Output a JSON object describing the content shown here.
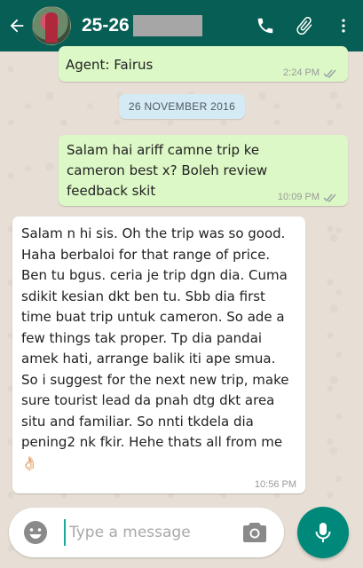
{
  "header": {
    "title": "25-26 Nov S",
    "back_icon": "arrow-left-icon",
    "actions": [
      "phone-icon",
      "paperclip-icon",
      "more-vert-icon"
    ]
  },
  "messages": [
    {
      "direction": "out",
      "text": "Agent: Fairus",
      "time": "2:24 PM",
      "status": "read"
    },
    {
      "direction": "out",
      "text": "Salam hai ariff camne trip ke cameron best x? Boleh review feedback skit",
      "time": "10:09 PM",
      "status": "read"
    },
    {
      "direction": "in",
      "text": "Salam n hi sis. Oh the trip was so good. Haha berbaloi for that range of price. Ben tu bgus. ceria je trip dgn dia. Cuma sdikit kesian dkt ben tu. Sbb dia first time buat trip untuk cameron. So ade a few things tak proper. Tp dia pandai amek hati, arrange balik iti ape smua. So i suggest for the next new trip, make sure tourist lead da pnah dtg dkt area situ and familiar. So nnti tkdela dia pening2 nk fkir. Hehe thats all from me",
      "emoji": "👌🏻",
      "time": "10:56 PM"
    }
  ],
  "date_divider": "26 NOVEMBER 2016",
  "composer": {
    "placeholder": "Type a message",
    "value": ""
  },
  "colors": {
    "header": "#075e54",
    "outgoing_bubble": "#dcf8c6",
    "incoming_bubble": "#ffffff",
    "mic_button": "#00897b"
  }
}
